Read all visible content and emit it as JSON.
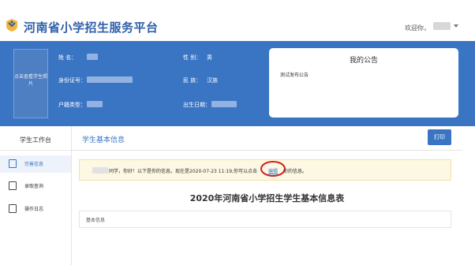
{
  "header": {
    "site_title": "河南省小学招生服务平台",
    "welcome": "欢迎你，"
  },
  "student": {
    "photo_hint": "点击查看学生照片",
    "name_label": "姓    名：",
    "id_label": "身份证号：",
    "hukou_label": "户籍类型：",
    "gender_label": "性    别：",
    "gender_value": "男",
    "ethnicity_label": "民    族：",
    "ethnicity_value": "汉族",
    "birthday_label": "出生日期："
  },
  "notice": {
    "title": "我的公告",
    "items": [
      "测试发布公告"
    ]
  },
  "sidebar": {
    "header": "学生工作台",
    "items": [
      {
        "label": "完善信息",
        "icon": "edit-doc-icon"
      },
      {
        "label": "录取查询",
        "icon": "search-doc-icon"
      },
      {
        "label": "操作日志",
        "icon": "log-icon"
      }
    ]
  },
  "main": {
    "title": "学生基本信息",
    "print_label": "打印",
    "alert_pre": "同学，你好！以下是你的信息。现在是2020-07-23 11:19,你可以点击",
    "alert_link": "编辑",
    "alert_post": "你的信息。",
    "form_title": "2020年河南省小学招生学生基本信息表",
    "section_label": "基本信息"
  },
  "colors": {
    "brand_blue": "#3a75c4",
    "alert_bg": "#fcf8e3",
    "highlight_red": "#d21e1e"
  }
}
